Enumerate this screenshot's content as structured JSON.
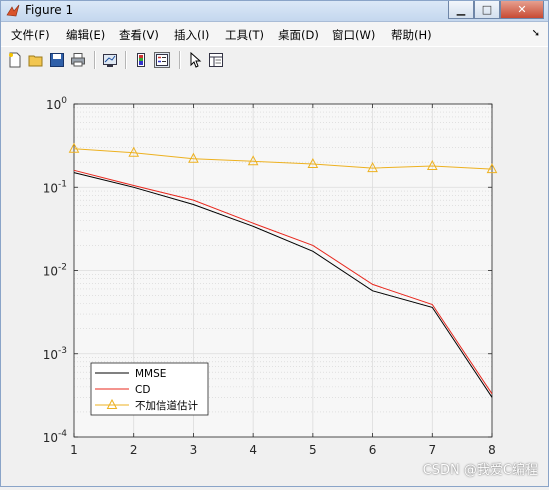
{
  "window": {
    "title": "Figure 1"
  },
  "menu": [
    "文件(F)",
    "编辑(E)",
    "查看(V)",
    "插入(I)",
    "工具(T)",
    "桌面(D)",
    "窗口(W)",
    "帮助(H)"
  ],
  "toolbar": [
    "new-figure-icon",
    "open-file-icon",
    "save-icon",
    "print-icon",
    "link-plot-icon",
    "colorbar-icon",
    "legend-icon",
    "edit-plot-arrow-icon",
    "property-inspector-icon"
  ],
  "watermark": "CSDN @我爱C编程",
  "chart_data": {
    "type": "line",
    "x": [
      1,
      2,
      3,
      4,
      5,
      6,
      7,
      8
    ],
    "xticks": [
      "1",
      "2",
      "3",
      "4",
      "5",
      "6",
      "7",
      "8"
    ],
    "yscale": "log",
    "ylim": [
      0.0001,
      1
    ],
    "yticks": [
      {
        "base": "10",
        "exp": "0"
      },
      {
        "base": "10",
        "exp": "-1"
      },
      {
        "base": "10",
        "exp": "-2"
      },
      {
        "base": "10",
        "exp": "-3"
      },
      {
        "base": "10",
        "exp": "-4"
      }
    ],
    "grid": true,
    "legend_position": "bottom-left",
    "series": [
      {
        "name": "MMSE",
        "color": "#000000",
        "marker": "none",
        "values": [
          0.15,
          0.1,
          0.062,
          0.034,
          0.017,
          0.0057,
          0.0036,
          0.0003
        ]
      },
      {
        "name": "CD",
        "color": "#e8281e",
        "marker": "none",
        "values": [
          0.16,
          0.105,
          0.07,
          0.037,
          0.02,
          0.0068,
          0.0039,
          0.00033
        ]
      },
      {
        "name": "不加信道估计",
        "color": "#edb120",
        "marker": "triangle",
        "values": [
          0.29,
          0.26,
          0.22,
          0.205,
          0.19,
          0.17,
          0.18,
          0.165
        ]
      }
    ]
  }
}
